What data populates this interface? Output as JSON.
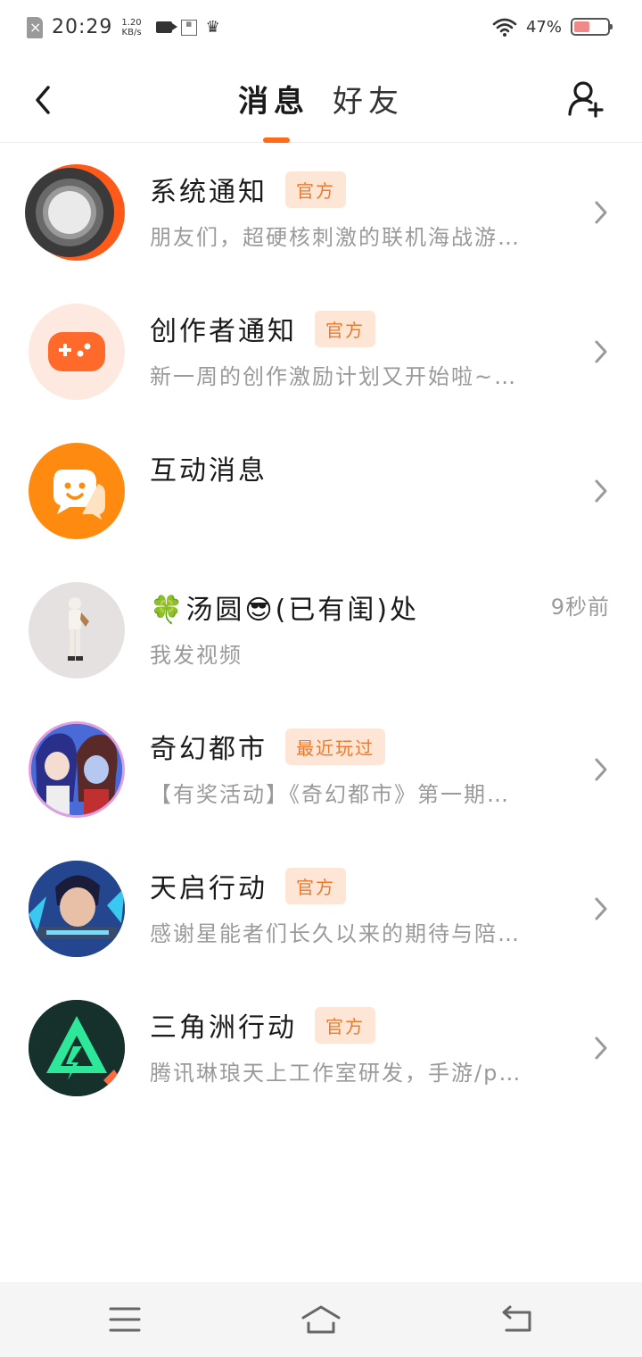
{
  "status_bar": {
    "time": "20:29",
    "speed_value": "1.20",
    "speed_unit": "KB/s",
    "battery_percent": "47%",
    "battery_level": 0.47,
    "icons": [
      "sim-disabled-icon",
      "video-camera-icon",
      "news-app-icon",
      "crown-icon",
      "wifi-icon",
      "battery-icon"
    ]
  },
  "header": {
    "tabs": [
      {
        "label": "消息",
        "active": true
      },
      {
        "label": "好友",
        "active": false
      }
    ],
    "accent_color": "#ff6a1a"
  },
  "messages": [
    {
      "title": "系统通知",
      "badge": "官方",
      "preview": "朋友们，超硬核刺激的联机海战游…",
      "time": "",
      "avatar": "system-notification-avatar"
    },
    {
      "title": "创作者通知",
      "badge": "官方",
      "preview": "新一周的创作激励计划又开始啦~…",
      "time": "",
      "avatar": "gamepad-avatar"
    },
    {
      "title": "互动消息",
      "badge": "",
      "preview": "",
      "time": "",
      "avatar": "chat-bubble-avatar"
    },
    {
      "title": "🍀汤圆😎(已有闺)处",
      "badge": "",
      "preview": "我发视频",
      "time": "9秒前",
      "avatar": "user-avatar"
    },
    {
      "title": "奇幻都市",
      "badge": "最近玩过",
      "preview": "【有奖活动】《奇幻都市》第一期…",
      "time": "",
      "avatar": "fantasy-city-avatar"
    },
    {
      "title": "天启行动",
      "badge": "官方",
      "preview": "感谢星能者们长久以来的期待与陪…",
      "time": "",
      "avatar": "apocalypse-action-avatar"
    },
    {
      "title": "三角洲行动",
      "badge": "官方",
      "preview": "腾讯琳琅天上工作室研发，手游/p…",
      "time": "",
      "avatar": "delta-force-avatar"
    }
  ],
  "nav_bar": {
    "icons": [
      "menu-icon",
      "home-icon",
      "back-icon"
    ]
  }
}
